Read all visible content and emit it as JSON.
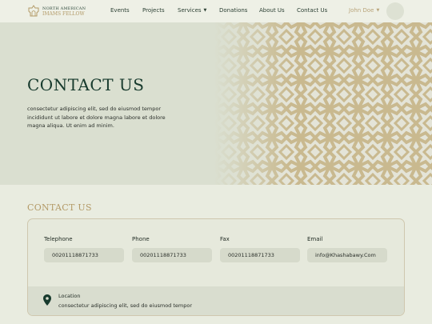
{
  "nav": {
    "logo_line1": "NORTH AMERICAN",
    "logo_line2": "IMAMS FELLOW",
    "items": [
      "Events",
      "Projects",
      "Services",
      "Donations",
      "About Us",
      "Contact Us"
    ],
    "user_name": "John Doe"
  },
  "hero": {
    "title": "CONTACT US",
    "text": "consectetur adipiscing elit, sed do eiusmod tempor incididunt ut labore et dolore magna labore et dolore magna aliqua. Ut enim ad minim."
  },
  "contact": {
    "section_title": "CONTACT US",
    "fields": [
      {
        "label": "Telephone",
        "value": "00201118871733"
      },
      {
        "label": "Phone",
        "value": "00201118871733"
      },
      {
        "label": "Fax",
        "value": "00201118871733"
      },
      {
        "label": "Email",
        "value": "info@Khashabawy.Com"
      }
    ],
    "location_label": "Location",
    "location_text": "consectetur adipiscing elit, sed do eiusmod tempor"
  },
  "colors": {
    "accent_gold": "#b39a67",
    "dark_green": "#173a2d",
    "background": "#e9ece0"
  }
}
